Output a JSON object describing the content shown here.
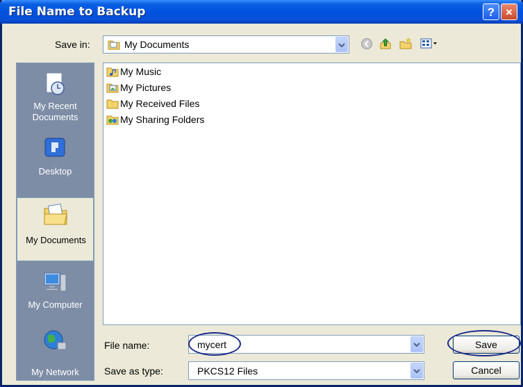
{
  "window": {
    "title": "File Name to Backup"
  },
  "titlebar": {
    "help_glyph": "?",
    "close_glyph": "×"
  },
  "savein": {
    "label": "Save in:",
    "value": "My Documents"
  },
  "toolbar": {
    "icons": [
      "back-icon",
      "up-folder-icon",
      "new-folder-icon",
      "views-menu-icon"
    ]
  },
  "places": [
    {
      "label": "My Recent\nDocuments",
      "icon": "recent-documents-icon"
    },
    {
      "label": "Desktop",
      "icon": "desktop-icon"
    },
    {
      "label": "My Documents",
      "icon": "my-documents-icon",
      "selected": true
    },
    {
      "label": "My Computer",
      "icon": "my-computer-icon"
    },
    {
      "label": "My Network",
      "icon": "my-network-icon"
    }
  ],
  "files": [
    {
      "name": "My Music",
      "icon": "music-folder-icon"
    },
    {
      "name": "My Pictures",
      "icon": "pictures-folder-icon"
    },
    {
      "name": "My Received Files",
      "icon": "folder-icon"
    },
    {
      "name": "My Sharing Folders",
      "icon": "sharing-folder-icon"
    }
  ],
  "filename": {
    "label": "File name:",
    "value": "mycert"
  },
  "filetype": {
    "label": "Save as type:",
    "value": "PKCS12 Files"
  },
  "buttons": {
    "save": "Save",
    "cancel": "Cancel"
  },
  "colors": {
    "title_bar": "#0053E0",
    "dialog_bg": "#ECE9D8",
    "annotation": "#1A2A8A"
  }
}
